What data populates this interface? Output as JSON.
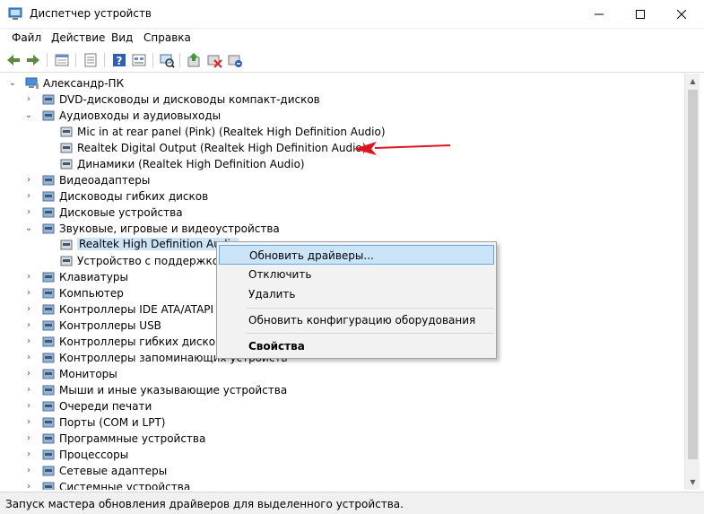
{
  "window": {
    "title": "Диспетчер устройств",
    "minimize_icon": "minimize-icon",
    "maximize_icon": "maximize-icon",
    "close_icon": "close-icon"
  },
  "menu": [
    "Файл",
    "Действие",
    "Вид",
    "Справка"
  ],
  "toolbar": {
    "buttons": [
      "back-icon",
      "forward-icon",
      "properties-icon",
      "list-icon",
      "help-icon",
      "view-icon",
      "scan-icon",
      "update-driver-icon",
      "disable-icon",
      "uninstall-icon"
    ]
  },
  "tree": {
    "root": "Александр-ПК",
    "items": [
      {
        "label": "DVD-дисководы и дисководы компакт-дисков",
        "level": 1,
        "expander": "›"
      },
      {
        "label": "Аудиовходы и аудиовыходы",
        "level": 1,
        "expander": "⌄"
      },
      {
        "label": "Mic in at rear panel (Pink) (Realtek High Definition Audio)",
        "level": 2,
        "expander": ""
      },
      {
        "label": "Realtek Digital Output (Realtek High Definition Audio)",
        "level": 2,
        "expander": ""
      },
      {
        "label": "Динамики (Realtek High Definition Audio)",
        "level": 2,
        "expander": ""
      },
      {
        "label": "Видеоадаптеры",
        "level": 1,
        "expander": "›"
      },
      {
        "label": "Дисководы гибких дисков",
        "level": 1,
        "expander": "›"
      },
      {
        "label": "Дисковые устройства",
        "level": 1,
        "expander": "›"
      },
      {
        "label": "Звуковые, игровые и видеоустройства",
        "level": 1,
        "expander": "⌄"
      },
      {
        "label": "Realtek High Definition Audio",
        "level": 2,
        "expander": "",
        "selected": true
      },
      {
        "label": "Устройство с поддержкой High Definition Audio",
        "level": 2,
        "expander": ""
      },
      {
        "label": "Клавиатуры",
        "level": 1,
        "expander": "›"
      },
      {
        "label": "Компьютер",
        "level": 1,
        "expander": "›"
      },
      {
        "label": "Контроллеры IDE ATA/ATAPI",
        "level": 1,
        "expander": "›"
      },
      {
        "label": "Контроллеры USB",
        "level": 1,
        "expander": "›"
      },
      {
        "label": "Контроллеры гибких дисков",
        "level": 1,
        "expander": "›"
      },
      {
        "label": "Контроллеры запоминающих устройств",
        "level": 1,
        "expander": "›"
      },
      {
        "label": "Мониторы",
        "level": 1,
        "expander": "›"
      },
      {
        "label": "Мыши и иные указывающие устройства",
        "level": 1,
        "expander": "›"
      },
      {
        "label": "Очереди печати",
        "level": 1,
        "expander": "›"
      },
      {
        "label": "Порты (COM и LPT)",
        "level": 1,
        "expander": "›"
      },
      {
        "label": "Программные устройства",
        "level": 1,
        "expander": "›"
      },
      {
        "label": "Процессоры",
        "level": 1,
        "expander": "›"
      },
      {
        "label": "Сетевые адаптеры",
        "level": 1,
        "expander": "›"
      },
      {
        "label": "Системные устройства",
        "level": 1,
        "expander": "›"
      }
    ]
  },
  "context_menu": {
    "update": "Обновить драйверы...",
    "disable": "Отключить",
    "uninstall": "Удалить",
    "scan": "Обновить конфигурацию оборудования",
    "properties": "Свойства"
  },
  "status": "Запуск мастера обновления драйверов для выделенного устройства.",
  "colors": {
    "highlight": "#cce4f7",
    "annotation_arrow": "#e0141c"
  }
}
